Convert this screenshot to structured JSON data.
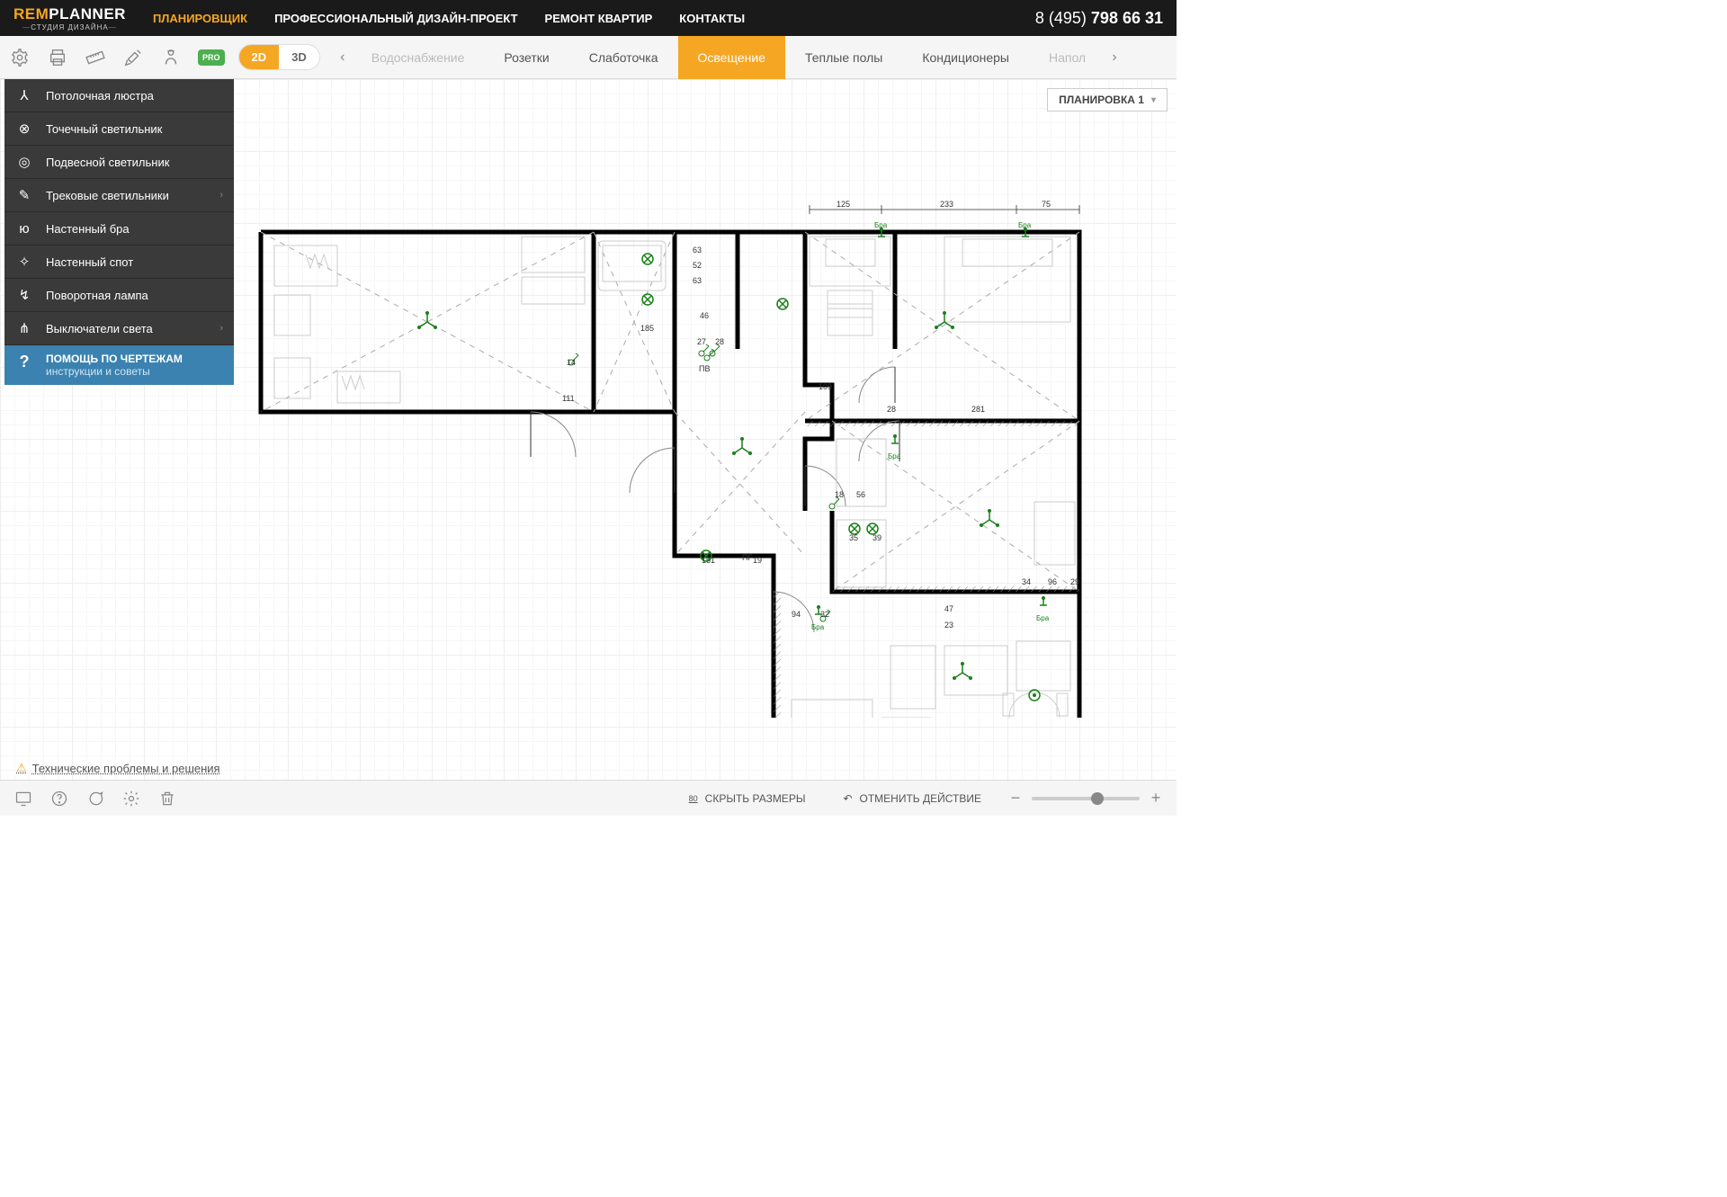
{
  "header": {
    "logo_main_prefix": "REM",
    "logo_main_suffix": "PLANNER",
    "logo_sub": "СТУДИЯ ДИЗАЙНА",
    "nav": [
      "ПЛАНИРОВЩИК",
      "ПРОФЕССИОНАЛЬНЫЙ ДИЗАЙН-ПРОЕКТ",
      "РЕМОНТ КВАРТИР",
      "КОНТАКТЫ"
    ],
    "phone_code": "8 (495) ",
    "phone_number": "798 66 31"
  },
  "toolbar": {
    "pro_label": "PRO",
    "view_2d": "2D",
    "view_3d": "3D",
    "tabs": [
      "Водоснабжение",
      "Розетки",
      "Слаботочка",
      "Освещение",
      "Теплые полы",
      "Кондиционеры",
      "Напол"
    ]
  },
  "layout_selector": "ПЛАНИРОВКА 1",
  "side_panel": {
    "items": [
      {
        "label": "Потолочная люстра",
        "chevron": false
      },
      {
        "label": "Точечный светильник",
        "chevron": false
      },
      {
        "label": "Подвесной светильник",
        "chevron": false
      },
      {
        "label": "Трековые светильники",
        "chevron": true
      },
      {
        "label": "Настенный бра",
        "chevron": false
      },
      {
        "label": "Настенный спот",
        "chevron": false
      },
      {
        "label": "Поворотная лампа",
        "chevron": false
      },
      {
        "label": "Выключатели света",
        "chevron": true
      }
    ],
    "help_title": "ПОМОЩЬ ПО ЧЕРТЕЖАМ",
    "help_sub": "инструкции и советы"
  },
  "plan": {
    "top_dims": [
      "125",
      "233",
      "75"
    ],
    "labels": {
      "bra": "Бра",
      "pv": "ПВ",
      "pg": "ПГ"
    },
    "dims": {
      "d63a": "63",
      "d52": "52",
      "d63b": "63",
      "d185": "185",
      "d27": "27",
      "d28": "28",
      "d14": "14",
      "d111": "111",
      "d109": "109",
      "d28b": "28",
      "d281": "281",
      "d18": "18",
      "d56": "56",
      "d35": "35",
      "d39": "39",
      "d151": "151",
      "d19": "19",
      "d34": "34",
      "d96": "96",
      "d29": "29",
      "d94": "94",
      "d32": "32",
      "d47": "47",
      "d23": "23",
      "d46": "46"
    }
  },
  "issues_link": "Технические проблемы и решения",
  "bottom": {
    "hide_sizes": "СКРЫТЬ РАЗМЕРЫ",
    "hide_sizes_count": "80",
    "undo": "ОТМЕНИТЬ ДЕЙСТВИЕ"
  }
}
